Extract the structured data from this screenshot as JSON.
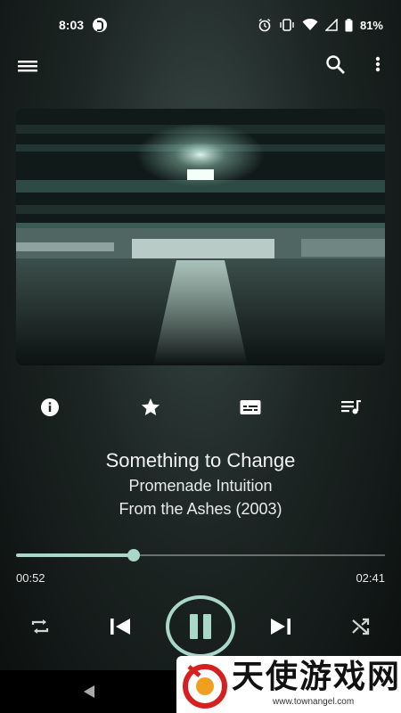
{
  "status_bar": {
    "time": "8:03",
    "battery": "81%"
  },
  "app_bar": {
    "icons": [
      "menu-icon",
      "search-icon",
      "more-vert-icon"
    ]
  },
  "actions": {
    "icons": [
      "info-icon",
      "star-icon",
      "lyrics-icon",
      "queue-icon"
    ]
  },
  "track": {
    "title": "Something to Change",
    "artist": "Promenade Intuition",
    "album": "From the Ashes (2003)"
  },
  "progress": {
    "elapsed": "00:52",
    "total": "02:41",
    "fraction": 0.32
  },
  "controls": {
    "icons": [
      "repeat-icon",
      "skip-previous-icon",
      "pause-icon",
      "skip-next-icon",
      "shuffle-icon"
    ]
  },
  "colors": {
    "accent": "#a9d8c8",
    "background": "#1d2624"
  },
  "watermark": {
    "text": "天使游戏网",
    "url": "www.townangel.com"
  }
}
